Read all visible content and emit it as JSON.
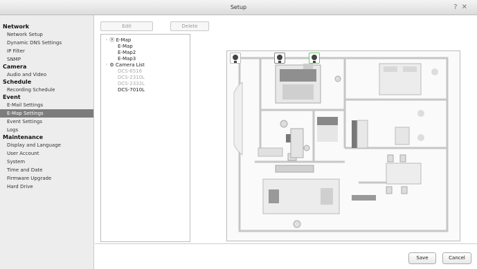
{
  "window": {
    "title": "Setup",
    "help_icon": "?",
    "close_icon": "✕"
  },
  "sidebar": {
    "groups": [
      {
        "label": "Network",
        "items": [
          "Network Setup",
          "Dynamic DNS Settings",
          "IP Filter",
          "SNMP"
        ]
      },
      {
        "label": "Camera",
        "items": [
          "Audio and Video"
        ]
      },
      {
        "label": "Schedule",
        "items": [
          "Recording Schedule"
        ]
      },
      {
        "label": "Event",
        "items": [
          "E-Mail Settings",
          "E-Map Settings",
          "Event Settings",
          "Logs"
        ]
      },
      {
        "label": "Maintenance",
        "items": [
          "Display and Language",
          "User Account",
          "System",
          "Time and Date",
          "Firmware Upgrade",
          "Hard Drive"
        ]
      }
    ],
    "selected": "E-Map Settings"
  },
  "toolbar": {
    "edit_label": "Edit",
    "delete_label": "Delete"
  },
  "tree": {
    "emap_root": "E-Map",
    "maps": [
      "E-Map",
      "E-Map2",
      "E-Map3"
    ],
    "camera_root": "Camera List",
    "cameras": [
      "DCS-6516",
      "DCS-2310L",
      "DCS-2332L",
      "DCS-7010L"
    ],
    "active_camera": "DCS-7010L"
  },
  "footer": {
    "save_label": "Save",
    "cancel_label": "Cancel"
  },
  "colors": {
    "selected_bg": "#7c7c7c",
    "camera_highlight": "#66cc66"
  }
}
